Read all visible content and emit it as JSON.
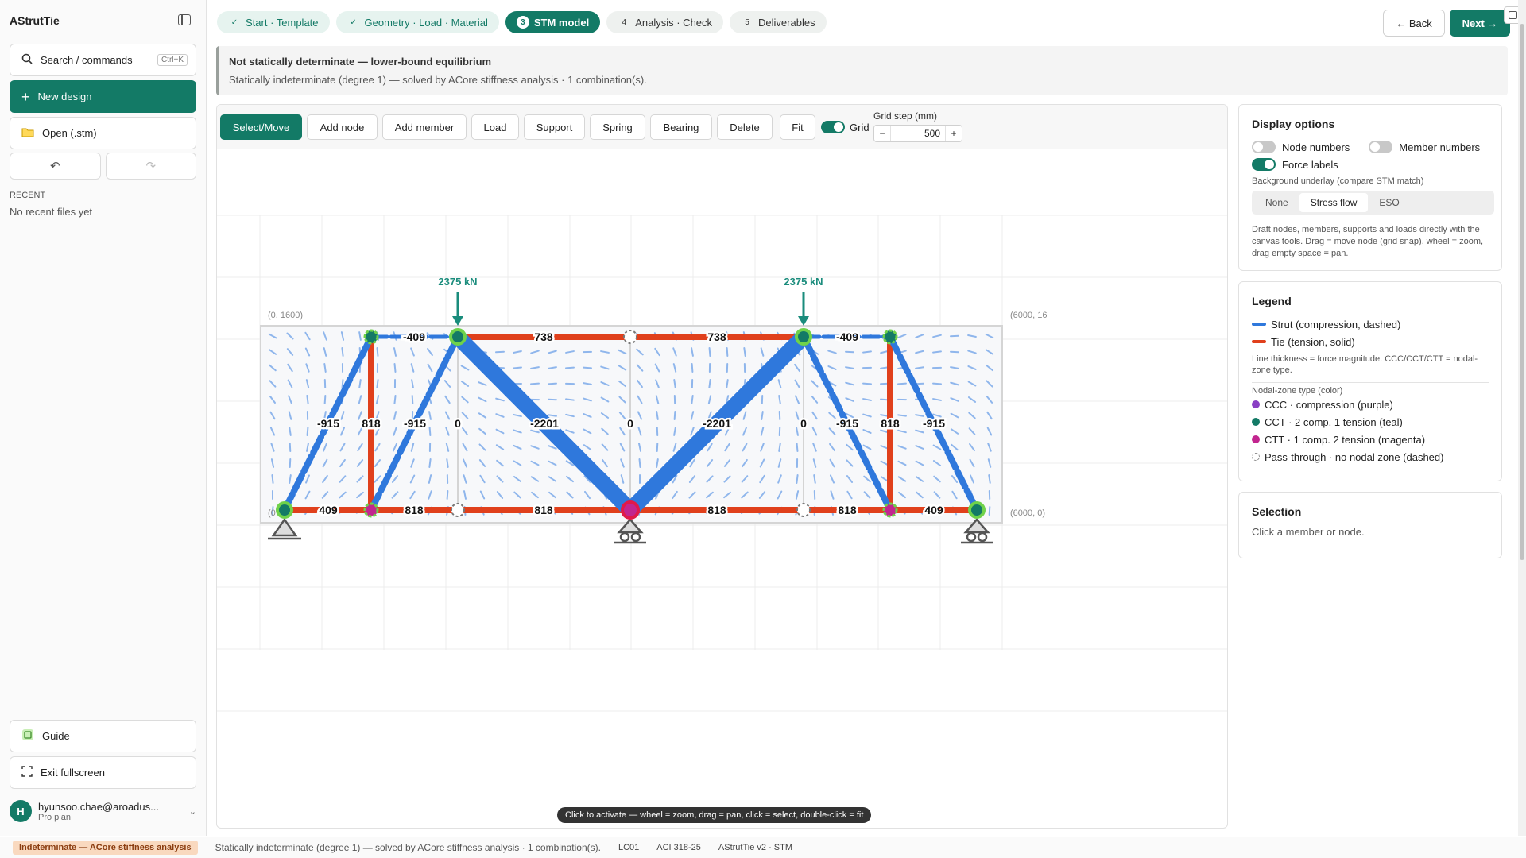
{
  "sidebar": {
    "app_title": "AStrutTie",
    "search": {
      "label": "Search / commands",
      "shortcut": "Ctrl+K"
    },
    "new_design_label": "New design",
    "open_label": "Open (.stm)",
    "undo_symbol": "↶",
    "redo_symbol": "↷",
    "recent_heading": "RECENT",
    "recent_empty": "No recent files yet",
    "guide_label": "Guide",
    "exit_fullscreen_label": "Exit fullscreen",
    "user": {
      "initial": "H",
      "email": "hyunsoo.chae@aroadus...",
      "plan": "Pro plan"
    }
  },
  "stepper": {
    "steps": [
      {
        "label": "Start · Template",
        "status": "done",
        "marker": "✓"
      },
      {
        "label": "Geometry · Load · Material",
        "status": "done",
        "marker": "✓"
      },
      {
        "label": "STM model",
        "status": "current",
        "marker": "3"
      },
      {
        "label": "Analysis · Check",
        "status": "todo",
        "marker": "4"
      },
      {
        "label": "Deliverables",
        "status": "todo",
        "marker": "5"
      }
    ],
    "back_label": "← Back",
    "next_label": "Next →"
  },
  "banner": {
    "title": "Not statically determinate — lower-bound equilibrium",
    "subtitle": "Statically indeterminate (degree 1) — solved by ACore stiffness analysis · 1 combination(s)."
  },
  "toolbar": {
    "buttons": [
      "Select/Move",
      "Add node",
      "Add member",
      "Load",
      "Support",
      "Spring",
      "Bearing",
      "Delete",
      "Fit"
    ],
    "active_button": "Select/Move",
    "grid_label": "Grid",
    "grid_on": true,
    "grid_step_label": "Grid step (mm)",
    "grid_step_value": "500",
    "minus": "−",
    "plus": "+"
  },
  "canvas": {
    "coord_labels": {
      "top_left": "(0, 1600)",
      "top_right": "(6000, 16",
      "bottom_left": "(0",
      "bottom_right": "(6000, 0)"
    },
    "load_labels": [
      "2375 kN",
      "2375 kN"
    ],
    "force_labels": {
      "top": [
        "-409",
        "738",
        "738",
        "-409"
      ],
      "middle": [
        "-915",
        "818",
        "-915",
        "0",
        "-2201",
        "0",
        "-2201",
        "0",
        "-915",
        "818",
        "-915"
      ],
      "bottom": [
        "409",
        "818",
        "818",
        "818",
        "818",
        "409"
      ]
    },
    "hint": "Click to activate — wheel = zoom, drag = pan, click = select, double-click = fit",
    "colors": {
      "strut": "#2f78dc",
      "tie": "#e0401c",
      "ccc": "#8a3fc4",
      "cct": "#137a66",
      "ctt": "#c2258f",
      "node_ring": "#6fd24a"
    }
  },
  "display_options": {
    "title": "Display options",
    "node_numbers_label": "Node numbers",
    "node_numbers_on": false,
    "member_numbers_label": "Member numbers",
    "member_numbers_on": false,
    "force_labels_label": "Force labels",
    "force_labels_on": true,
    "underlay_label": "Background underlay (compare STM match)",
    "underlay_options": [
      "None",
      "Stress flow",
      "ESO"
    ],
    "underlay_selected": "Stress flow",
    "help": "Draft nodes, members, supports and loads directly with the canvas tools. Drag = move node (grid snap), wheel = zoom, drag empty space = pan."
  },
  "legend": {
    "title": "Legend",
    "strut": "Strut (compression, dashed)",
    "tie": "Tie (tension, solid)",
    "thickness_note": "Line thickness = force magnitude. CCC/CCT/CTT = nodal-zone type.",
    "nodal_heading": "Nodal-zone type (color)",
    "ccc": "CCC · compression (purple)",
    "cct": "CCT · 2 comp. 1 tension (teal)",
    "ctt": "CTT · 1 comp. 2 tension (magenta)",
    "pass": "Pass-through · no nodal zone (dashed)"
  },
  "selection": {
    "title": "Selection",
    "empty": "Click a member or node."
  },
  "statusbar": {
    "badge": "Indeterminate — ACore stiffness analysis",
    "message": "Statically indeterminate (degree 1) — solved by ACore stiffness analysis · 1 combination(s).",
    "load_case": "LC01",
    "code": "ACI 318-25",
    "version": "AStrutTie v2 · STM"
  }
}
